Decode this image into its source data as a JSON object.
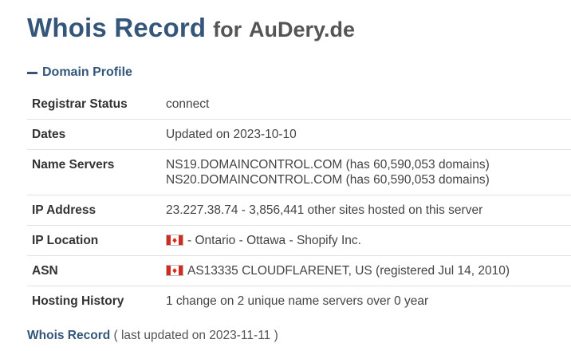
{
  "header": {
    "title_main": "Whois Record",
    "title_for": "for",
    "domain": "AuDery.de"
  },
  "section": {
    "label": "Domain Profile",
    "icon": "minus-icon"
  },
  "profile": {
    "registrar_status": {
      "key": "Registrar Status",
      "value": "connect"
    },
    "dates": {
      "key": "Dates",
      "value": "Updated on 2023-10-10"
    },
    "name_servers": {
      "key": "Name Servers",
      "values": [
        "NS19.DOMAINCONTROL.COM (has 60,590,053 domains)",
        "NS20.DOMAINCONTROL.COM (has 60,590,053 domains)"
      ]
    },
    "ip_address": {
      "key": "IP Address",
      "value": "23.227.38.74 - 3,856,441 other sites hosted on this server"
    },
    "ip_location": {
      "key": "IP Location",
      "value": "- Ontario - Ottawa - Shopify Inc.",
      "flag": "canada-flag-icon"
    },
    "asn": {
      "key": "ASN",
      "value": "AS13335 CLOUDFLARENET, US (registered Jul 14, 2010)",
      "flag": "canada-flag-icon"
    },
    "hosting_history": {
      "key": "Hosting History",
      "value": "1 change on 2 unique name servers over 0 year"
    }
  },
  "footer": {
    "link": "Whois Record",
    "note": "( last updated on 2023-11-11 )"
  },
  "colors": {
    "accent": "#34567a",
    "flag_red": "#d52b1e",
    "row_border": "#e2e2e2"
  }
}
